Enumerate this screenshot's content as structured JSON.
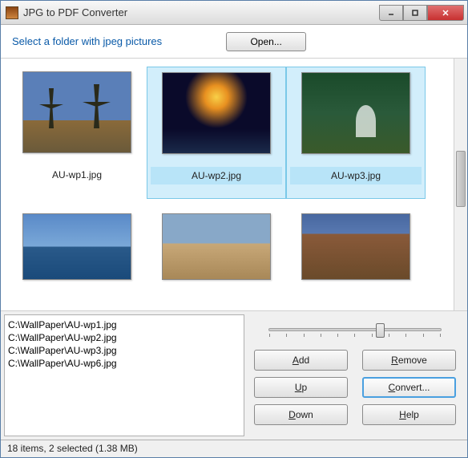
{
  "window": {
    "title": "JPG to PDF Converter"
  },
  "toolbar": {
    "label": "Select a folder with jpeg pictures",
    "open": "Open..."
  },
  "thumbs": [
    {
      "label": "AU-wp1.jpg",
      "selected": false,
      "style": "img-trees"
    },
    {
      "label": "AU-wp2.jpg",
      "selected": true,
      "style": "img-fireworks"
    },
    {
      "label": "AU-wp3.jpg",
      "selected": true,
      "style": "img-forest"
    },
    {
      "label": "",
      "selected": false,
      "style": "img-city"
    },
    {
      "label": "",
      "selected": false,
      "style": "img-rocks"
    },
    {
      "label": "",
      "selected": false,
      "style": "img-canyon"
    }
  ],
  "filelist": [
    "C:\\WallPaper\\AU-wp1.jpg",
    "C:\\WallPaper\\AU-wp2.jpg",
    "C:\\WallPaper\\AU-wp3.jpg",
    "C:\\WallPaper\\AU-wp6.jpg"
  ],
  "buttons": {
    "add": "Add",
    "remove": "Remove",
    "up": "Up",
    "convert": "Convert...",
    "down": "Down",
    "help": "Help"
  },
  "status": "18 items, 2 selected (1.38 MB)"
}
